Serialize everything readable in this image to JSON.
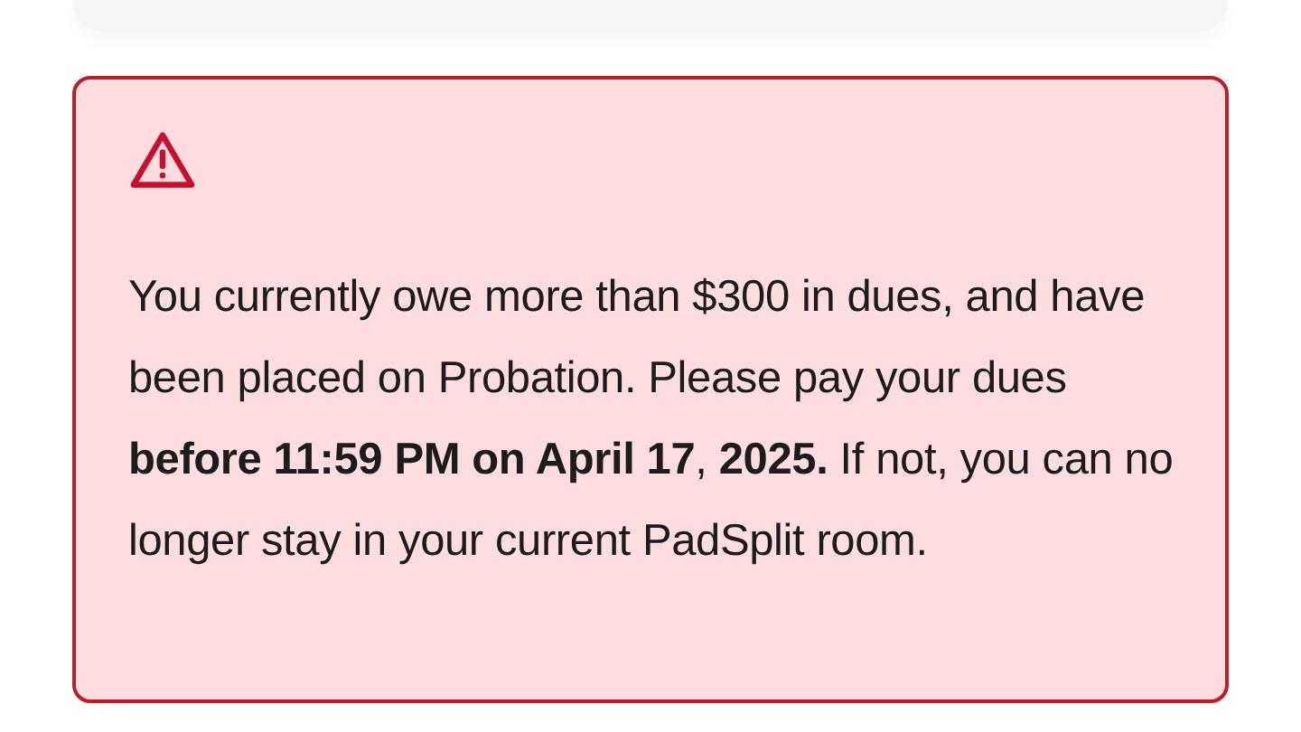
{
  "alert": {
    "kind": "warning",
    "message": "You currently owe more than $300 in dues, and have been placed on Probation. Please pay your dues **before 11:59 PM on April 17**, **2025.** If not, you can no longer stay in your current PadSplit room."
  }
}
